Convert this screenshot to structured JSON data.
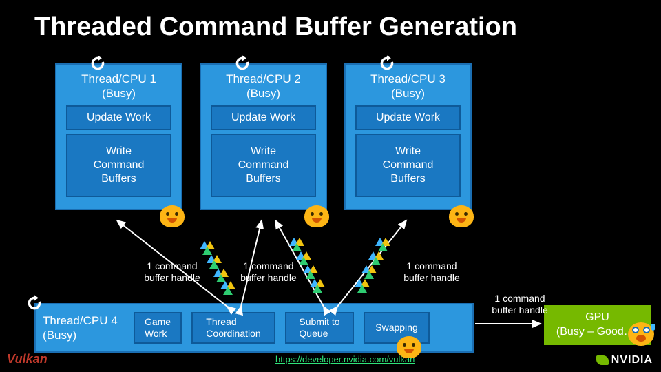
{
  "title": "Threaded Command Buffer Generation",
  "threads": [
    {
      "header": "Thread/CPU 1\n(Busy)",
      "update": "Update Work",
      "write": "Write\nCommand\nBuffers"
    },
    {
      "header": "Thread/CPU 2\n(Busy)",
      "update": "Update Work",
      "write": "Write\nCommand\nBuffers"
    },
    {
      "header": "Thread/CPU 3\n(Busy)",
      "update": "Update Work",
      "write": "Write\nCommand\nBuffers"
    }
  ],
  "thread4": {
    "header": "Thread/CPU 4\n(Busy)",
    "boxes": [
      "Game\nWork",
      "Thread\nCoordination",
      "Submit to\nQueue",
      "Swapping"
    ]
  },
  "gpu": "GPU\n(Busy – Good…)",
  "labels": {
    "cb1": "1 command\nbuffer handle",
    "cb2": "1 command\nbuffer handle",
    "cb3": "1 command\nbuffer handle",
    "cb4": "1 command\nbuffer handle"
  },
  "link": "https://developer.nvidia.com/vulkan",
  "logos": {
    "vulkan": "Vulkan",
    "nvidia": "NVIDIA"
  },
  "icons": {
    "spin": "spin-icon",
    "face_happy": "face-happy-icon",
    "face_shock": "face-shock-icon"
  },
  "colors": {
    "thread_bg": "#2c97de",
    "sub_bg": "#1a78c2",
    "gpu_bg": "#76b900",
    "accent_link": "#2fe37a"
  }
}
